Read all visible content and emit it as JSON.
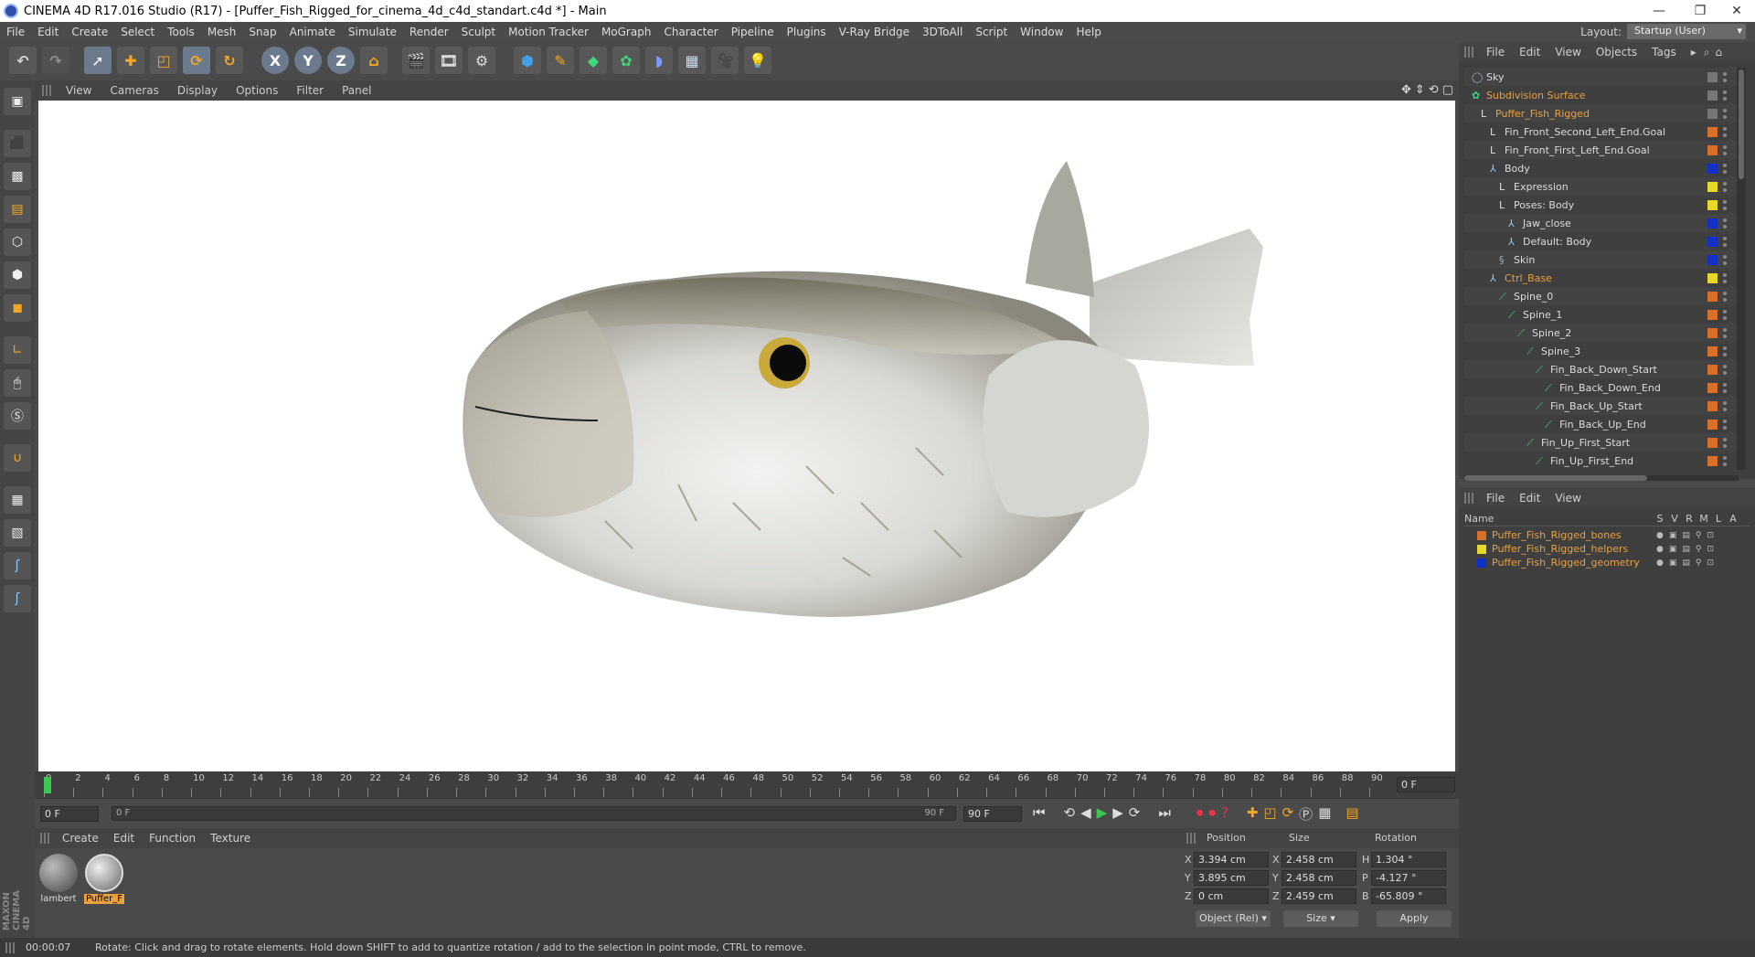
{
  "title": "CINEMA 4D R17.016 Studio (R17) - [Puffer_Fish_Rigged_for_cinema_4d_c4d_standart.c4d *] - Main",
  "window_controls": {
    "minimize": "—",
    "restore": "❐",
    "close": "✕"
  },
  "menu": [
    "File",
    "Edit",
    "Create",
    "Select",
    "Tools",
    "Mesh",
    "Snap",
    "Animate",
    "Simulate",
    "Render",
    "Sculpt",
    "Motion Tracker",
    "MoGraph",
    "Character",
    "Pipeline",
    "Plugins",
    "V-Ray Bridge",
    "3DToAll",
    "Script",
    "Window",
    "Help"
  ],
  "layout": {
    "label": "Layout:",
    "value": "Startup (User)"
  },
  "toolbar_axes": [
    "X",
    "Y",
    "Z"
  ],
  "viewport_menu": [
    "View",
    "Cameras",
    "Display",
    "Options",
    "Filter",
    "Panel"
  ],
  "timeline": {
    "ticks": [
      "0",
      "2",
      "4",
      "6",
      "8",
      "10",
      "12",
      "14",
      "16",
      "18",
      "20",
      "22",
      "24",
      "26",
      "28",
      "30",
      "32",
      "34",
      "36",
      "38",
      "40",
      "42",
      "44",
      "46",
      "48",
      "50",
      "52",
      "54",
      "56",
      "58",
      "60",
      "62",
      "64",
      "66",
      "68",
      "70",
      "72",
      "74",
      "76",
      "78",
      "80",
      "82",
      "84",
      "86",
      "88",
      "90"
    ],
    "current_frame": "0 F",
    "start": "0 F",
    "range_start": "0 F",
    "range_end": "90 F",
    "end": "90 F",
    "playhead_frame": 0,
    "range_max_frame": 90
  },
  "material_menu": [
    "Create",
    "Edit",
    "Function",
    "Texture"
  ],
  "materials": [
    {
      "name": "lambert",
      "selected": false
    },
    {
      "name": "Puffer_F",
      "selected": true
    }
  ],
  "coords": {
    "headers": {
      "position": "Position",
      "size": "Size",
      "rotation": "Rotation"
    },
    "rows": [
      {
        "axis": "X",
        "pos": "3.394 cm",
        "size_axis": "X",
        "size": "2.458 cm",
        "rot_axis": "H",
        "rot": "1.304 °"
      },
      {
        "axis": "Y",
        "pos": "3.895 cm",
        "size_axis": "Y",
        "size": "2.458 cm",
        "rot_axis": "P",
        "rot": "-4.127 °"
      },
      {
        "axis": "Z",
        "pos": "0 cm",
        "size_axis": "Z",
        "size": "2.459 cm",
        "rot_axis": "B",
        "rot": "-65.809 °"
      }
    ],
    "mode": "Object (Rel)",
    "size_mode": "Size",
    "apply": "Apply"
  },
  "objects_menu": [
    "File",
    "Edit",
    "View",
    "Objects",
    "Tags"
  ],
  "objects": [
    {
      "name": "Sky",
      "depth": 0,
      "hl": false,
      "color": "#777777",
      "icon": "sky"
    },
    {
      "name": "Subdivision Surface",
      "depth": 0,
      "hl": true,
      "color": "#777777",
      "icon": "subdiv"
    },
    {
      "name": "Puffer_Fish_Rigged",
      "depth": 1,
      "hl": true,
      "color": "#777777",
      "icon": "null"
    },
    {
      "name": "Fin_Front_Second_Left_End.Goal",
      "depth": 2,
      "hl": false,
      "color": "#d8702a",
      "icon": "null"
    },
    {
      "name": "Fin_Front_First_Left_End.Goal",
      "depth": 2,
      "hl": false,
      "color": "#d8702a",
      "icon": "null"
    },
    {
      "name": "Body",
      "depth": 2,
      "hl": false,
      "color": "#1030c8",
      "icon": "mesh"
    },
    {
      "name": "Expression",
      "depth": 3,
      "hl": false,
      "color": "#e8d82a",
      "icon": "null"
    },
    {
      "name": "Poses: Body",
      "depth": 3,
      "hl": false,
      "color": "#e8d82a",
      "icon": "null"
    },
    {
      "name": "Jaw_close",
      "depth": 4,
      "hl": false,
      "color": "#1030c8",
      "icon": "mesh"
    },
    {
      "name": "Default: Body",
      "depth": 4,
      "hl": false,
      "color": "#1030c8",
      "icon": "mesh"
    },
    {
      "name": "Skin",
      "depth": 3,
      "hl": false,
      "color": "#1030c8",
      "icon": "skin"
    },
    {
      "name": "Ctrl_Base",
      "depth": 2,
      "hl": true,
      "color": "#e8d82a",
      "icon": "mesh"
    },
    {
      "name": "Spine_0",
      "depth": 3,
      "hl": false,
      "color": "#d8702a",
      "icon": "bone"
    },
    {
      "name": "Spine_1",
      "depth": 4,
      "hl": false,
      "color": "#d8702a",
      "icon": "bone"
    },
    {
      "name": "Spine_2",
      "depth": 5,
      "hl": false,
      "color": "#d8702a",
      "icon": "bone"
    },
    {
      "name": "Spine_3",
      "depth": 6,
      "hl": false,
      "color": "#d8702a",
      "icon": "bone"
    },
    {
      "name": "Fin_Back_Down_Start",
      "depth": 7,
      "hl": false,
      "color": "#d8702a",
      "icon": "bone"
    },
    {
      "name": "Fin_Back_Down_End",
      "depth": 8,
      "hl": false,
      "color": "#d8702a",
      "icon": "bone"
    },
    {
      "name": "Fin_Back_Up_Start",
      "depth": 7,
      "hl": false,
      "color": "#d8702a",
      "icon": "bone"
    },
    {
      "name": "Fin_Back_Up_End",
      "depth": 8,
      "hl": false,
      "color": "#d8702a",
      "icon": "bone"
    },
    {
      "name": "Fin_Up_First_Start",
      "depth": 6,
      "hl": false,
      "color": "#d8702a",
      "icon": "bone"
    },
    {
      "name": "Fin_Up_First_End",
      "depth": 7,
      "hl": false,
      "color": "#d8702a",
      "icon": "bone"
    }
  ],
  "layers_menu": [
    "File",
    "Edit",
    "View"
  ],
  "layers_header": {
    "name": "Name",
    "cols": [
      "S",
      "V",
      "R",
      "M",
      "L",
      "A"
    ]
  },
  "layers": [
    {
      "name": "Puffer_Fish_Rigged_bones",
      "color": "#d8702a"
    },
    {
      "name": "Puffer_Fish_Rigged_helpers",
      "color": "#e8d82a"
    },
    {
      "name": "Puffer_Fish_Rigged_geometry",
      "color": "#1030c8"
    }
  ],
  "status": {
    "time": "00:00:07",
    "message": "Rotate: Click and drag to rotate elements. Hold down SHIFT to add to quantize rotation / add to the selection in point mode, CTRL to remove."
  },
  "brand": "MAXON CINEMA 4D"
}
